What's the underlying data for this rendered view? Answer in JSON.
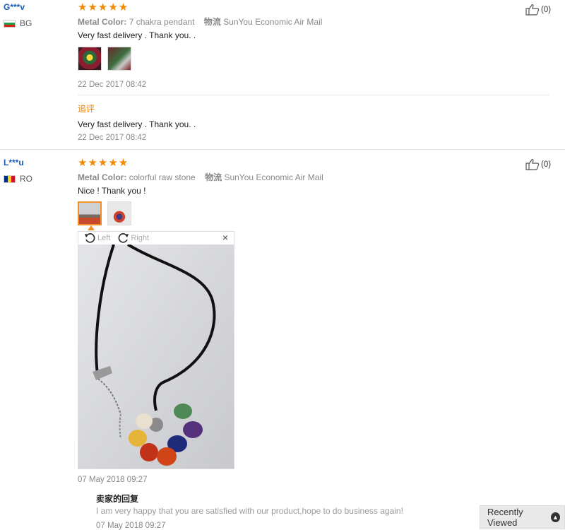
{
  "reviews": [
    {
      "user": "G***v",
      "country": "BG",
      "stars": "★★★★★",
      "meta_label1": "Metal Color:",
      "meta_value1": "7 chakra pendant",
      "meta_label2": "物流",
      "meta_value2": "SunYou Economic Air Mail",
      "text": "Very fast delivery . Thank you. .",
      "date": "22 Dec 2017 08:42",
      "likes": "(0)",
      "additional_label": "追评",
      "additional_text": "Very fast delivery . Thank you. .",
      "additional_date": "22 Dec 2017 08:42"
    },
    {
      "user": "L***u",
      "country": "RO",
      "stars": "★★★★★",
      "meta_label1": "Metal Color:",
      "meta_value1": "colorful raw stone",
      "meta_label2": "物流",
      "meta_value2": "SunYou Economic Air Mail",
      "text": "Nice ! Thank you !",
      "date": "07 May 2018 09:27",
      "likes": "(0)",
      "seller_reply_title": "卖家的回复",
      "seller_reply_text": "I am very happy that you are satisfied with our product,hope to do business again!",
      "seller_reply_date": "07 May 2018 09:27"
    }
  ],
  "viewer": {
    "rotate_left": "Left",
    "rotate_right": "Right",
    "close": "×"
  },
  "recently_viewed": "Recently Viewed",
  "colors": {
    "star": "#f08a05",
    "username": "#1a5bb5",
    "accent": "#f07d00"
  }
}
